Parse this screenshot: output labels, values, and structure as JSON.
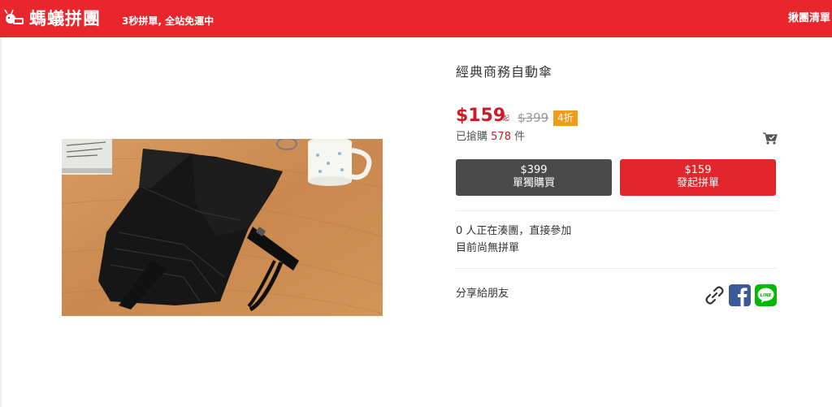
{
  "header": {
    "brand": "螞蟻拼團",
    "tagline": "3秒拼單, 全站免運中",
    "cart_link": "揪團清單",
    "logo_icon": "ant-logo-icon",
    "bg_color": "#e8262b"
  },
  "product": {
    "title": "經典商務自動傘",
    "image_icon": "folding-umbrella-photo",
    "price": "$159",
    "price_suffix": "起",
    "original_price": "$399",
    "discount_badge": "4折",
    "sold_prefix": "已搶購",
    "sold_count": "578",
    "sold_unit": "件",
    "cart_icon": "cart-icon"
  },
  "buttons": {
    "single": {
      "price": "$399",
      "label": "單獨購買"
    },
    "group": {
      "price": "$159",
      "label": "發起拼單"
    }
  },
  "group_status": {
    "joining": "0 人正在湊團，直接參加",
    "none": "目前尚無拼單"
  },
  "share": {
    "label": "分享給朋友",
    "icons": [
      "link-icon",
      "facebook-icon",
      "line-icon"
    ],
    "line_text": "LINE"
  },
  "colors": {
    "accent_red": "#e3262c",
    "price_red": "#c81d25",
    "discount_orange": "#f39a1a",
    "dark_button": "#4a4a4a",
    "facebook_blue": "#3b5998",
    "line_green": "#00b900"
  }
}
